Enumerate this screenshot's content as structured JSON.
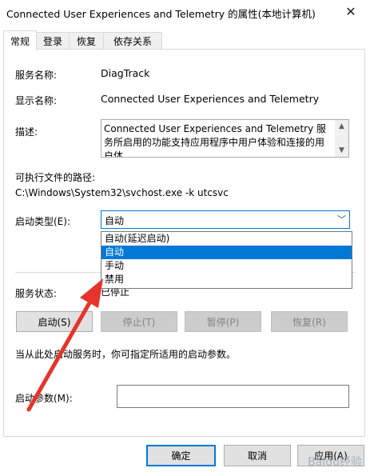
{
  "window": {
    "title": "Connected User Experiences and Telemetry 的属性(本地计算机)",
    "close_glyph": "✕"
  },
  "tabs": [
    {
      "label": "常规",
      "active": true
    },
    {
      "label": "登录",
      "active": false
    },
    {
      "label": "恢复",
      "active": false
    },
    {
      "label": "依存关系",
      "active": false
    }
  ],
  "general": {
    "service_name_label": "服务名称:",
    "service_name_value": "DiagTrack",
    "display_name_label": "显示名称:",
    "display_name_value": "Connected User Experiences and Telemetry",
    "description_label": "描述:",
    "description_value": "Connected User Experiences and Telemetry 服务所启用的功能支持应用程序中用户体验和连接的用户体",
    "path_label": "可执行文件的路径:",
    "path_value": "C:\\Windows\\System32\\svchost.exe -k utcsvc",
    "startup_type_label": "启动类型(E):",
    "startup_type_value": "自动",
    "startup_options": [
      "自动(延迟启动)",
      "自动",
      "手动",
      "禁用"
    ],
    "startup_selected_index": 1,
    "status_label": "服务状态:",
    "status_value": "已停止",
    "note": "当从此处启动服务时，你可指定所适用的启动参数。",
    "param_label": "启动参数(M):",
    "param_value": ""
  },
  "buttons": {
    "start": "启动(S)",
    "stop": "停止(T)",
    "pause": "暂停(P)",
    "resume": "恢复(R)",
    "ok": "确定",
    "cancel": "取消",
    "apply": "应用(A)"
  },
  "icons": {
    "close": "close-icon",
    "chevron": "chevron-down-icon",
    "scroll_up": "scroll-up-icon",
    "scroll_down": "scroll-down-icon"
  },
  "colors": {
    "accent": "#0078d7",
    "annotation_arrow": "#e5342b",
    "watermark": "#9aa9b6"
  },
  "watermark": {
    "text": "Baidu经验"
  }
}
